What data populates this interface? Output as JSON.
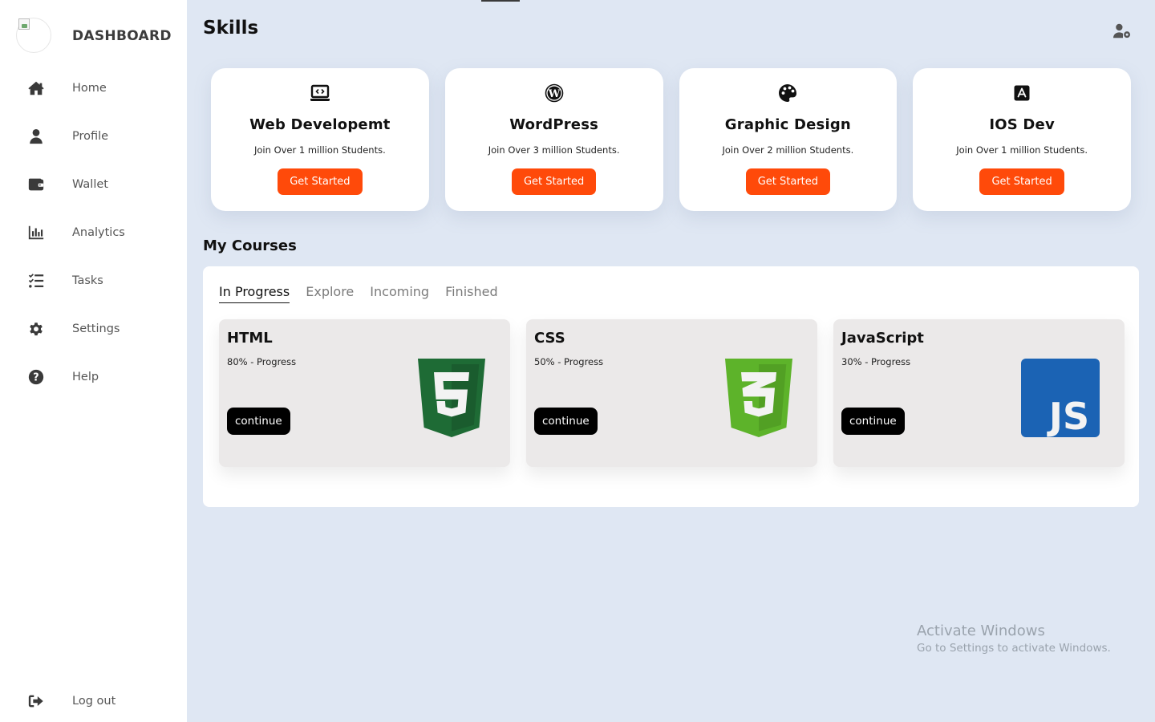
{
  "brand": "DASHBOARD",
  "nav": [
    {
      "label": "Home",
      "icon": "home-icon"
    },
    {
      "label": "Profile",
      "icon": "user-icon"
    },
    {
      "label": "Wallet",
      "icon": "wallet-icon"
    },
    {
      "label": "Analytics",
      "icon": "chart-icon"
    },
    {
      "label": "Tasks",
      "icon": "tasks-icon"
    },
    {
      "label": "Settings",
      "icon": "gear-icon"
    },
    {
      "label": "Help",
      "icon": "help-icon"
    }
  ],
  "logout": {
    "label": "Log out",
    "icon": "logout-icon"
  },
  "header": {
    "title": "Skills",
    "user_icon": "user-gear-icon"
  },
  "skills": [
    {
      "title": "Web Developemt",
      "sub": "Join Over 1 million Students.",
      "button": "Get Started",
      "icon": "laptop-code-icon"
    },
    {
      "title": "WordPress",
      "sub": "Join Over 3 million Students.",
      "button": "Get Started",
      "icon": "wordpress-icon"
    },
    {
      "title": "Graphic Design",
      "sub": "Join Over 2 million Students.",
      "button": "Get Started",
      "icon": "palette-icon"
    },
    {
      "title": "IOS Dev",
      "sub": "Join Over 1 million Students.",
      "button": "Get Started",
      "icon": "app-store-icon"
    }
  ],
  "courses": {
    "title": "My Courses",
    "tabs": [
      "In Progress",
      "Explore",
      "Incoming",
      "Finished"
    ],
    "active_tab": "In Progress",
    "items": [
      {
        "title": "HTML",
        "progress": "80% - Progress",
        "button": "continue",
        "logo": "html5-logo",
        "color": "#1e6b35"
      },
      {
        "title": "CSS",
        "progress": "50% - Progress",
        "button": "continue",
        "logo": "css3-logo",
        "color": "#5db32a"
      },
      {
        "title": "JavaScript",
        "progress": "30% - Progress",
        "button": "continue",
        "logo": "js-logo",
        "color": "#1b63b4"
      }
    ]
  },
  "watermark": {
    "line1": "Activate Windows",
    "line2": "Go to Settings to activate Windows."
  },
  "colors": {
    "accent": "#ff4a0a",
    "background": "#dfe7f3",
    "sidebar": "#ffffff"
  }
}
